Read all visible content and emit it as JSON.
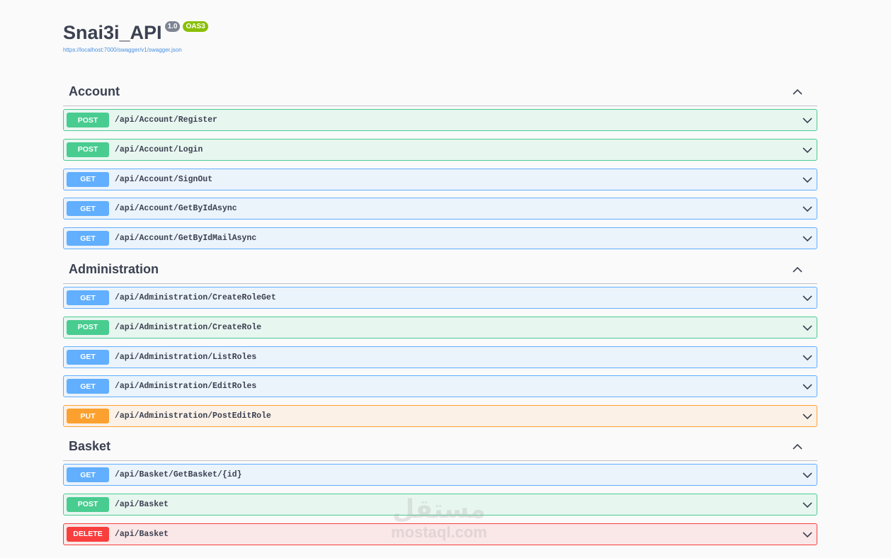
{
  "info": {
    "title": "Snai3i_API",
    "version": "1.0",
    "oas": "OAS3",
    "spec_url": "https://localhost:7000/swagger/v1/swagger.json"
  },
  "colors": {
    "post": "#49cc90",
    "get": "#61affe",
    "put": "#fca130",
    "delete": "#f93e3e"
  },
  "tags": [
    {
      "name": "Account",
      "operations": [
        {
          "method": "POST",
          "path": "/api/Account/Register"
        },
        {
          "method": "POST",
          "path": "/api/Account/Login"
        },
        {
          "method": "GET",
          "path": "/api/Account/SignOut"
        },
        {
          "method": "GET",
          "path": "/api/Account/GetByIdAsync"
        },
        {
          "method": "GET",
          "path": "/api/Account/GetByIdMailAsync"
        }
      ]
    },
    {
      "name": "Administration",
      "operations": [
        {
          "method": "GET",
          "path": "/api/Administration/CreateRoleGet"
        },
        {
          "method": "POST",
          "path": "/api/Administration/CreateRole"
        },
        {
          "method": "GET",
          "path": "/api/Administration/ListRoles"
        },
        {
          "method": "GET",
          "path": "/api/Administration/EditRoles"
        },
        {
          "method": "PUT",
          "path": "/api/Administration/PostEditRole"
        }
      ]
    },
    {
      "name": "Basket",
      "operations": [
        {
          "method": "GET",
          "path": "/api/Basket/GetBasket/{id}"
        },
        {
          "method": "POST",
          "path": "/api/Basket"
        },
        {
          "method": "DELETE",
          "path": "/api/Basket"
        }
      ]
    }
  ],
  "watermark": {
    "arabic": "مستقل",
    "latin": "mostaql.com"
  }
}
